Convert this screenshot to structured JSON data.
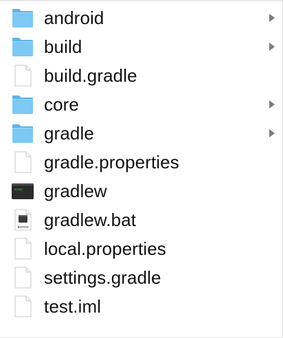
{
  "items": [
    {
      "name": "android",
      "type": "folder",
      "icon": "folder-icon",
      "has_children": true
    },
    {
      "name": "build",
      "type": "folder",
      "icon": "folder-icon",
      "has_children": true
    },
    {
      "name": "build.gradle",
      "type": "file",
      "icon": "document-icon",
      "has_children": false
    },
    {
      "name": "core",
      "type": "folder",
      "icon": "folder-icon",
      "has_children": true
    },
    {
      "name": "gradle",
      "type": "folder",
      "icon": "folder-icon",
      "has_children": true
    },
    {
      "name": "gradle.properties",
      "type": "file",
      "icon": "document-icon",
      "has_children": false
    },
    {
      "name": "gradlew",
      "type": "executable",
      "icon": "terminal-exec-icon",
      "icon_text": "exec",
      "has_children": false
    },
    {
      "name": "gradlew.bat",
      "type": "batch",
      "icon": "batch-file-icon",
      "icon_text": "BATCH",
      "has_children": false
    },
    {
      "name": "local.properties",
      "type": "file",
      "icon": "document-icon",
      "has_children": false
    },
    {
      "name": "settings.gradle",
      "type": "file",
      "icon": "document-icon",
      "has_children": false
    },
    {
      "name": "test.iml",
      "type": "file",
      "icon": "document-icon",
      "has_children": false
    }
  ],
  "colors": {
    "folder_front": "#7dc8f4",
    "folder_back": "#5fb3e8",
    "text": "#111111",
    "chevron": "#7c7c7c",
    "terminal_bg": "#2b2b2b",
    "terminal_text": "#35c74a"
  }
}
